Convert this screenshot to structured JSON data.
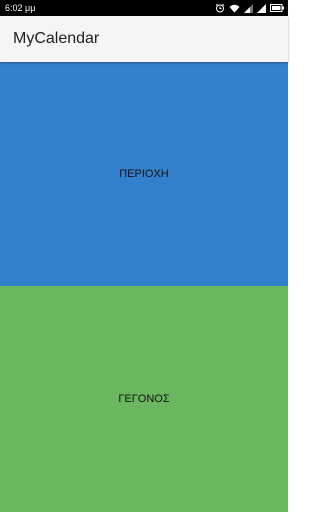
{
  "status_bar": {
    "time": "6:02 μμ",
    "icons": [
      "alarm-icon",
      "wifi-icon",
      "signal-icon",
      "signal-icon",
      "battery-icon"
    ]
  },
  "app_bar": {
    "title": "MyCalendar"
  },
  "tiles": [
    {
      "label": "ΠΕΡΙΟΧΗ",
      "color": "#3380cc"
    },
    {
      "label": "ΓΕΓΟΝΟΣ",
      "color": "#6bb75f"
    }
  ]
}
